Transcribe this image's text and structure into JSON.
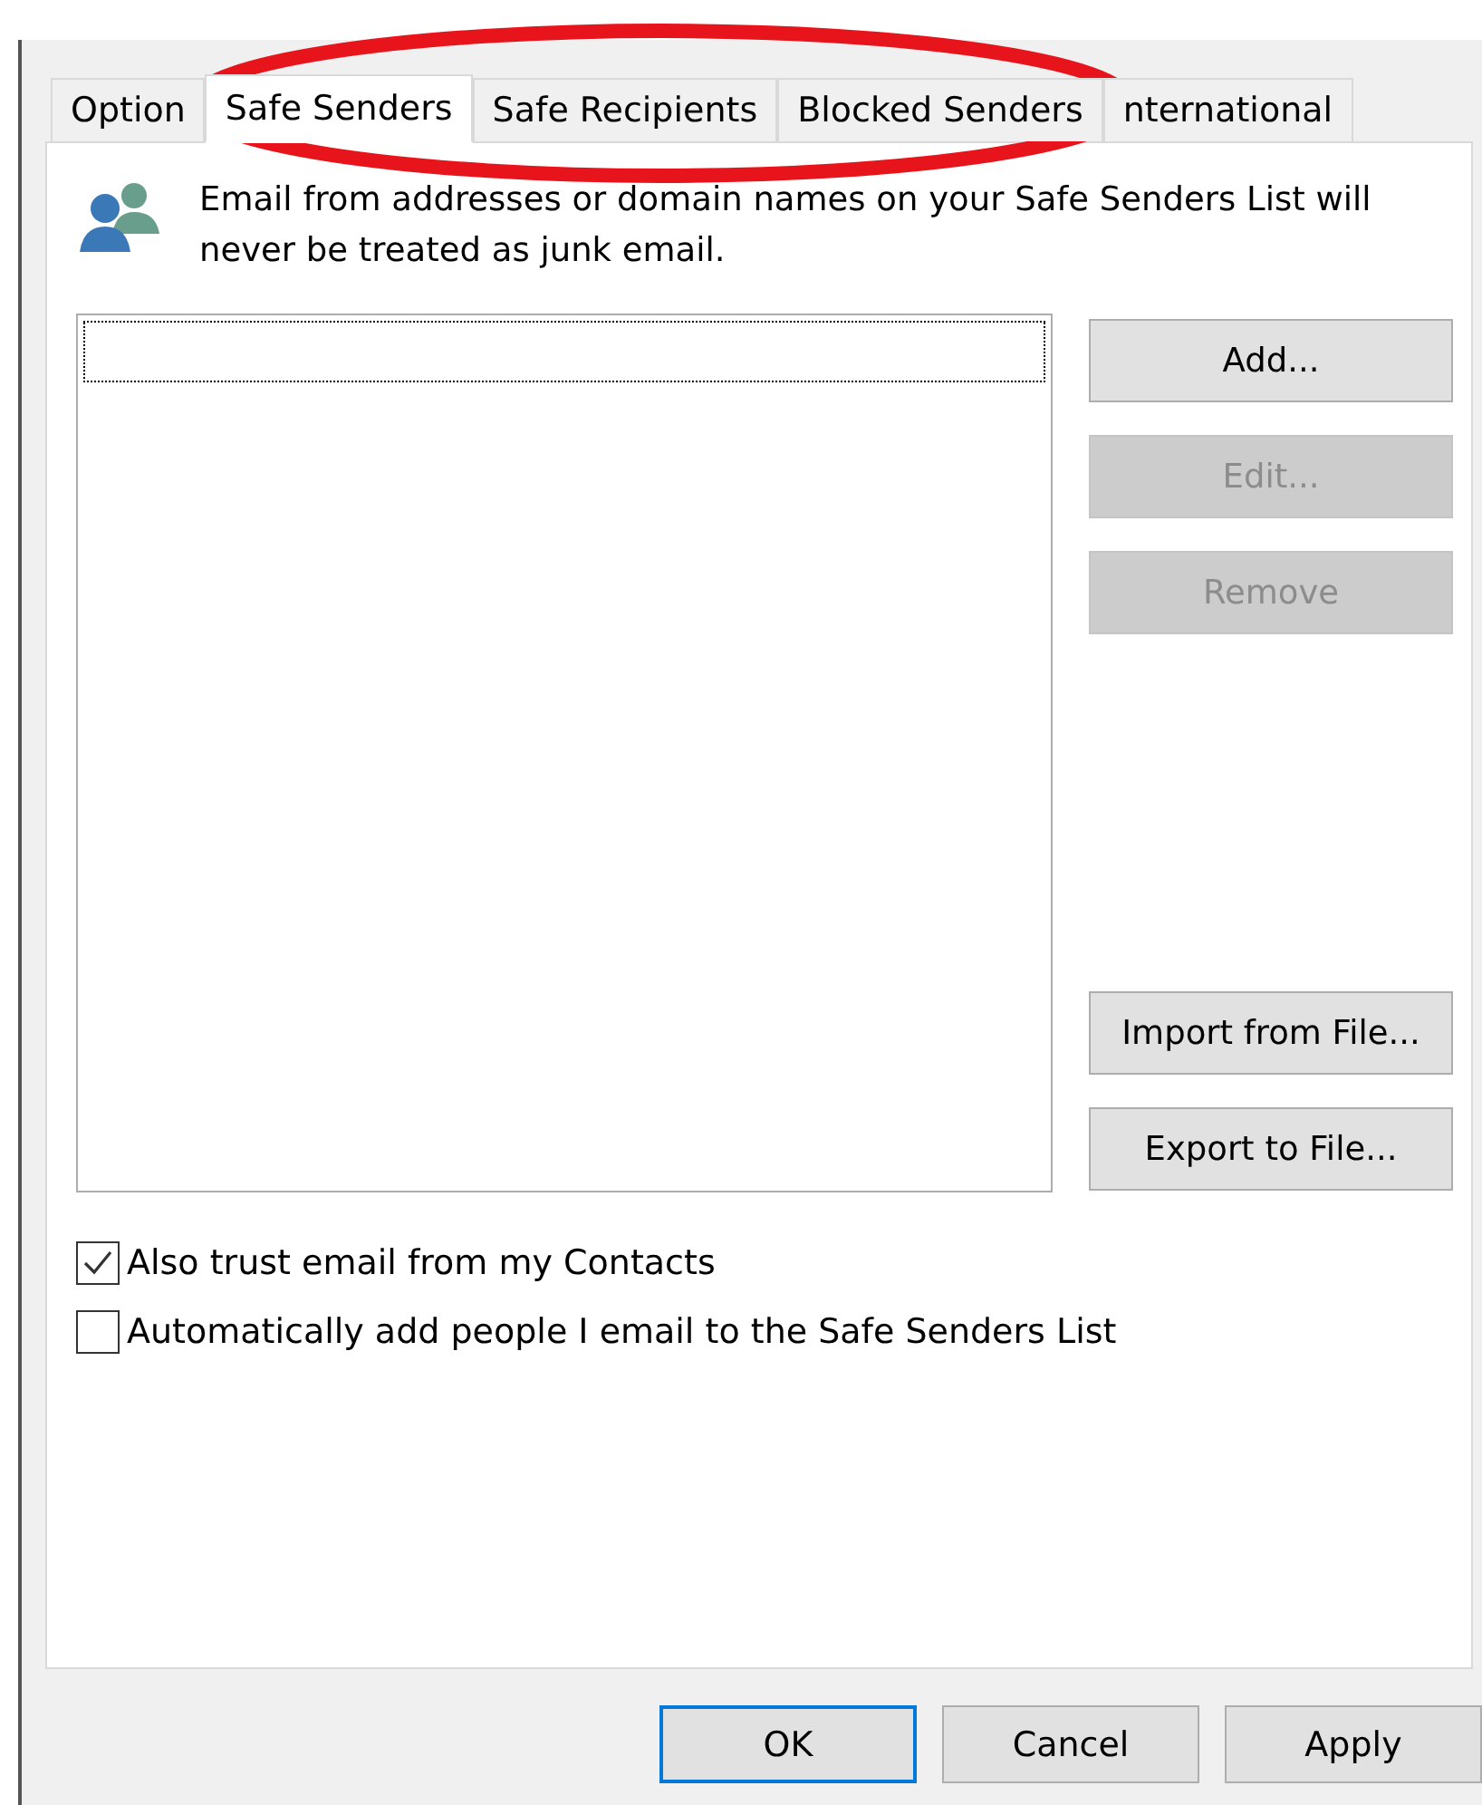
{
  "tabs": [
    {
      "label": "Option",
      "selected": false
    },
    {
      "label": "Safe Senders",
      "selected": true
    },
    {
      "label": "Safe Recipients",
      "selected": false
    },
    {
      "label": "Blocked Senders",
      "selected": false
    },
    {
      "label": "nternational",
      "selected": false
    }
  ],
  "description": "Email from addresses or domain names on your Safe Senders List will never be treated as junk email.",
  "list_buttons_top": [
    {
      "label": "Add...",
      "disabled": false
    },
    {
      "label": "Edit...",
      "disabled": true
    },
    {
      "label": "Remove",
      "disabled": true
    }
  ],
  "list_buttons_bottom": [
    {
      "label": "Import from File...",
      "disabled": false
    },
    {
      "label": "Export to File...",
      "disabled": false
    }
  ],
  "options": [
    {
      "label": "Also trust email from my Contacts",
      "checked": true
    },
    {
      "label": "Automatically add people I email to the Safe Senders List",
      "checked": false
    }
  ],
  "dialog_buttons": [
    {
      "label": "OK",
      "default": true
    },
    {
      "label": "Cancel",
      "default": false
    },
    {
      "label": "Apply",
      "default": false
    }
  ]
}
